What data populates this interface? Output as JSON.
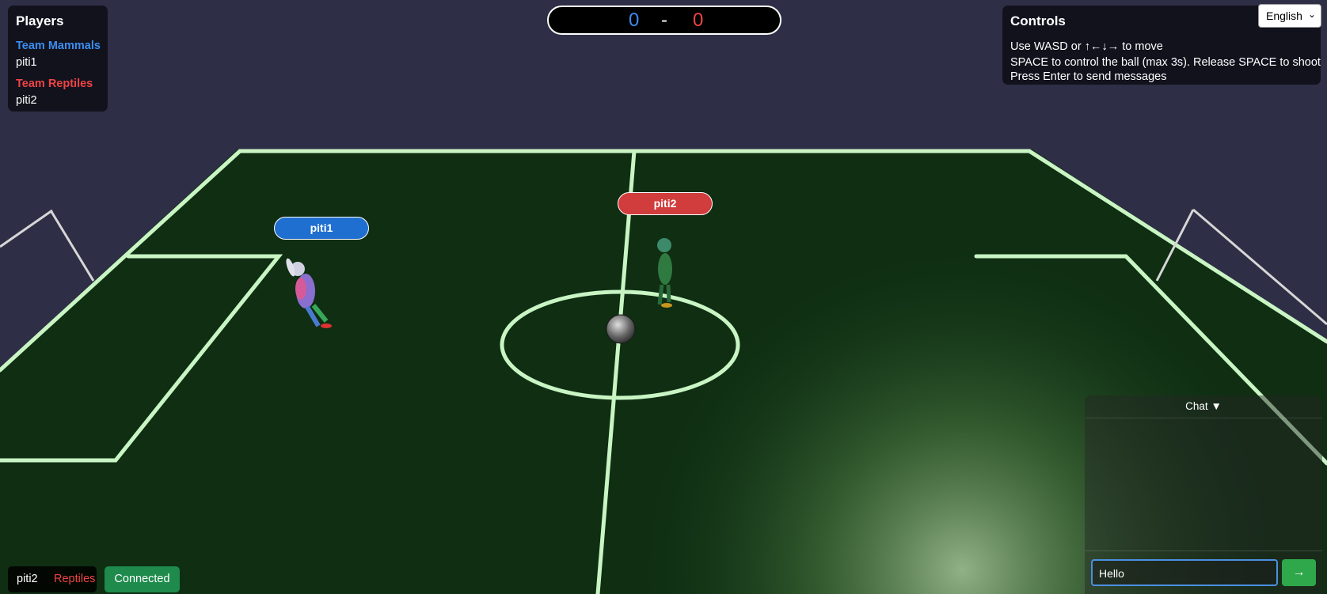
{
  "players_panel": {
    "title": "Players",
    "teams": [
      {
        "name": "Team Mammals",
        "color": "#3a8ef0",
        "players": [
          "piti1"
        ]
      },
      {
        "name": "Team Reptiles",
        "color": "#ee4444",
        "players": [
          "piti2"
        ]
      }
    ]
  },
  "scoreboard": {
    "home_score": "0",
    "separator": "-",
    "away_score": "0",
    "home_color": "#3a8ef0",
    "away_color": "#ee4444"
  },
  "controls": {
    "title": "Controls",
    "lines": [
      "Use WASD or ↑←↓→ to move",
      "SPACE to control the ball (max 3s). Release SPACE to shoot",
      "Press Enter to send messages"
    ]
  },
  "language": {
    "selected": "English",
    "icon": "chevron-down-icon"
  },
  "field_players": [
    {
      "name": "piti1",
      "tag_color": "#1f6fd1",
      "model": "rabbit"
    },
    {
      "name": "piti2",
      "tag_color": "#d13c3c",
      "model": "lizard"
    }
  ],
  "status": {
    "player_name": "piti2",
    "team": "Reptiles",
    "team_color": "#ee4444",
    "connection": "Connected"
  },
  "chat": {
    "toggle_label": "Chat ▼",
    "input_value": "Hello",
    "send_label": "→"
  }
}
